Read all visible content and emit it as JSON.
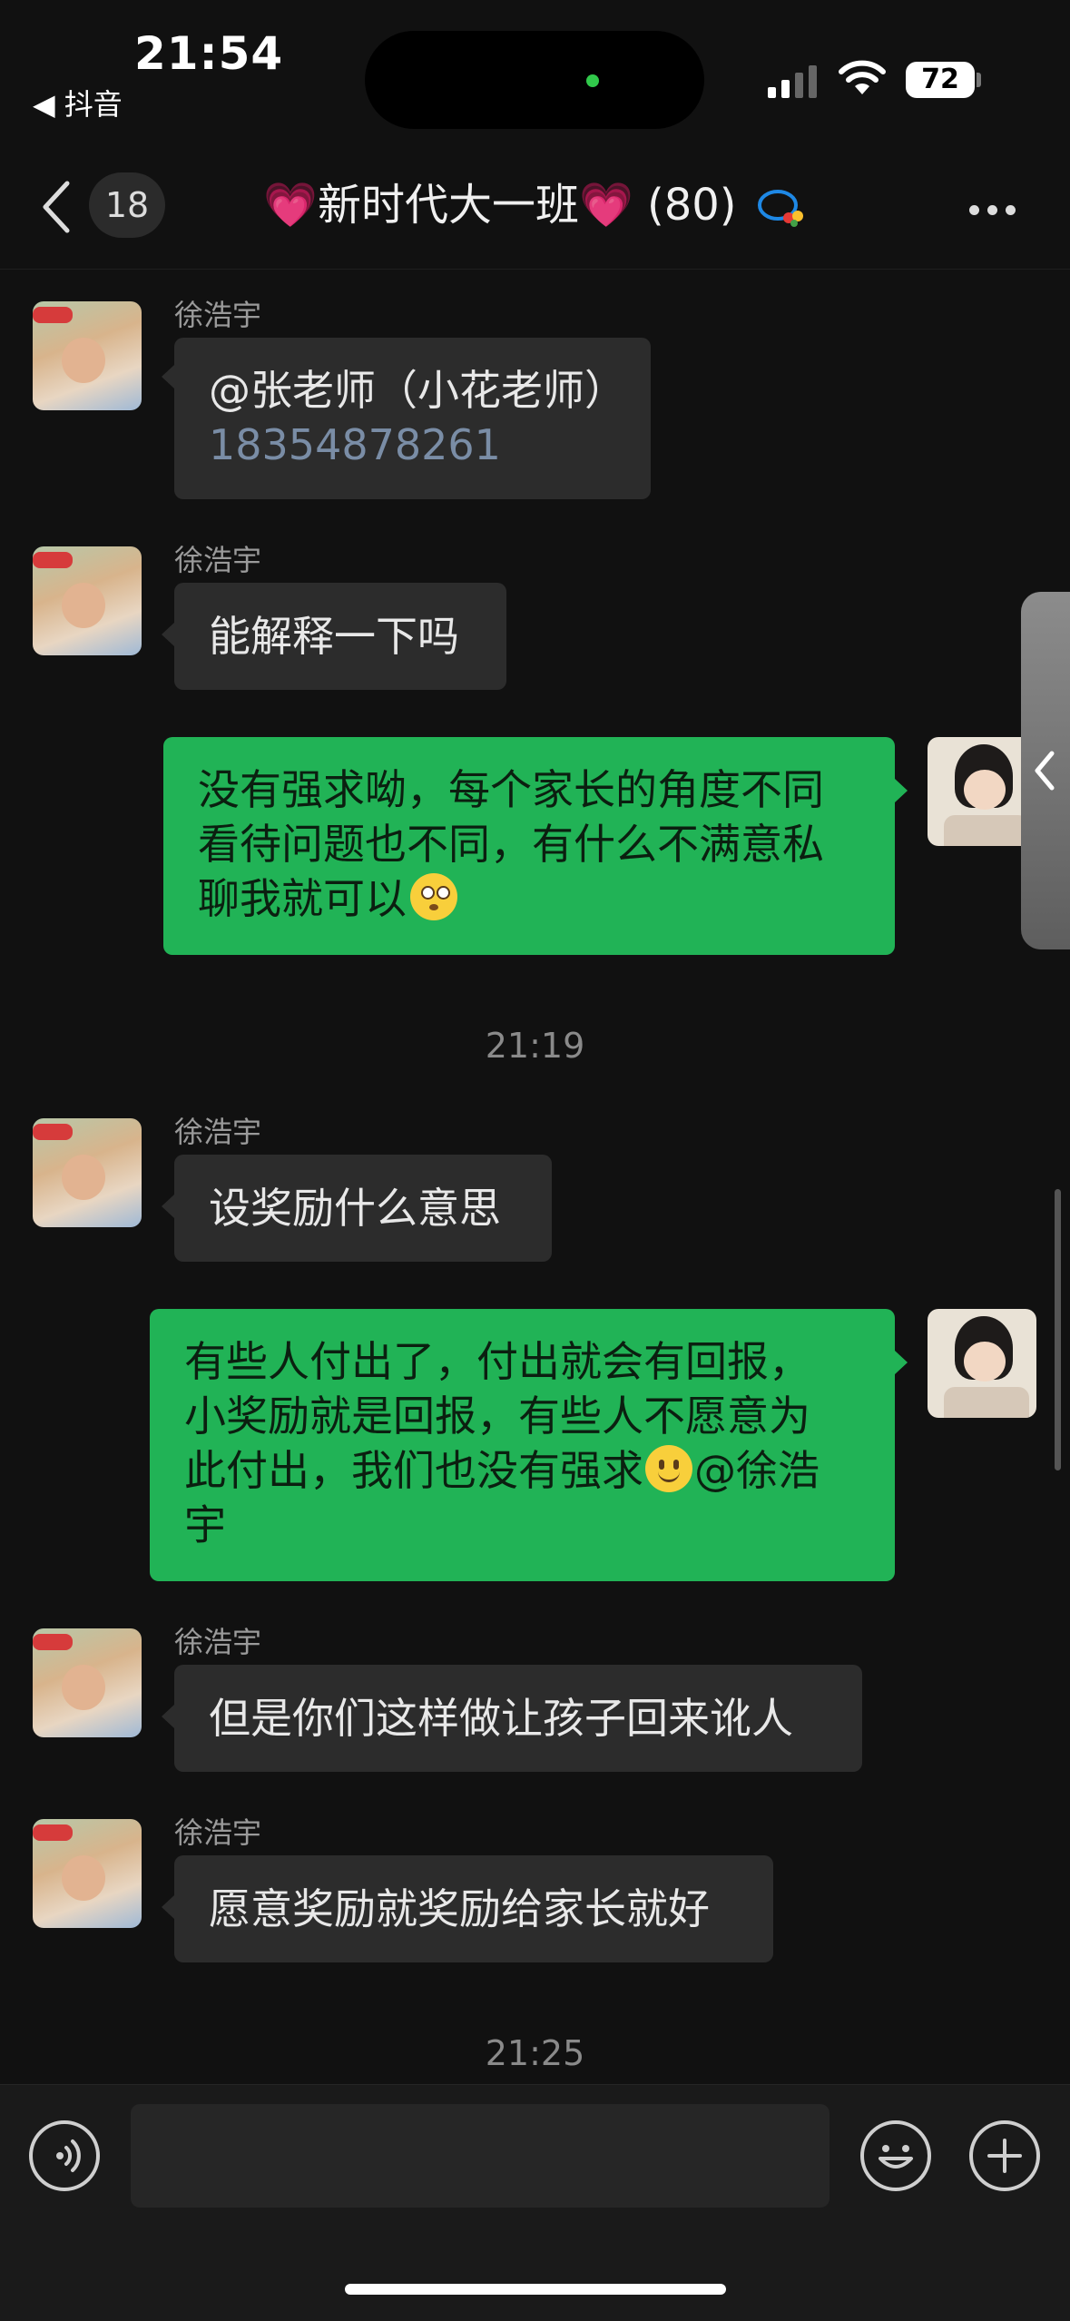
{
  "status_bar": {
    "time": "21:54",
    "back_app": "◀ 抖音",
    "battery": "72"
  },
  "header": {
    "unread_count": "18",
    "title": "💗新时代大一班💗 (80)",
    "back_icon": "chevron-left-icon",
    "more_icon": "more-dots-icon"
  },
  "messages": [
    {
      "type": "received",
      "sender": "徐浩宇",
      "lines": [
        "@张老师（小花老师）"
      ],
      "phone": "18354878261"
    },
    {
      "type": "received",
      "sender": "徐浩宇",
      "lines": [
        "能解释一下吗"
      ]
    },
    {
      "type": "sent",
      "lines": [
        "没有强求呦，每个家长的角度不同",
        "看待问题也不同，有什么不满意私",
        "聊我就可以"
      ],
      "emoji": "flushed-face"
    },
    {
      "type": "timestamp",
      "text": "21:19"
    },
    {
      "type": "received",
      "sender": "徐浩宇",
      "lines": [
        "设奖励什么意思"
      ]
    },
    {
      "type": "sent",
      "lines": [
        "有些人付出了，付出就会有回报，",
        "小奖励就是回报，有些人不愿意为",
        "此付出，我们也没有强求",
        "宇"
      ],
      "emoji": "slightly-smiling-face",
      "mention": "@徐浩"
    },
    {
      "type": "received",
      "sender": "徐浩宇",
      "lines": [
        "但是你们这样做让孩子回来讹人"
      ]
    },
    {
      "type": "received",
      "sender": "徐浩宇",
      "lines": [
        "愿意奖励就奖励给家长就好"
      ]
    },
    {
      "type": "timestamp",
      "text": "21:25"
    }
  ],
  "input_bar": {
    "voice_icon": "voice-icon",
    "emoji_icon": "emoji-icon",
    "plus_icon": "plus-icon",
    "placeholder": ""
  },
  "colors": {
    "background": "#111111",
    "received_bubble": "#2c2c2c",
    "sent_bubble": "#21b356"
  }
}
